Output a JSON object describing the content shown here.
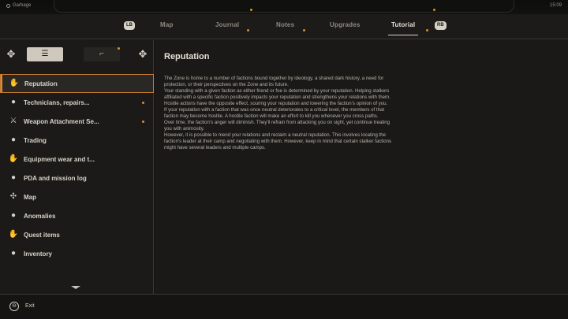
{
  "status_bar": {
    "location": "Garbage",
    "time": "15:09"
  },
  "nav": {
    "left_bumper": "LB",
    "right_bumper": "RB",
    "tabs": [
      {
        "label": "Map",
        "notify": false
      },
      {
        "label": "Journal",
        "notify": true
      },
      {
        "label": "Notes",
        "notify": true
      },
      {
        "label": "Upgrades",
        "notify": false
      },
      {
        "label": "Tutorial",
        "notify": true,
        "active": true
      }
    ]
  },
  "sidebar": {
    "tabs": [
      {
        "icon": "list-icon",
        "active": true
      },
      {
        "icon": "weapon-icon",
        "active": false,
        "notify": true
      }
    ],
    "items": [
      {
        "label": "Reputation",
        "icon": "hand-icon",
        "active": true
      },
      {
        "label": "Technicians, repairs...",
        "icon": "bag-icon",
        "notify": true
      },
      {
        "label": "Weapon Attachment Se...",
        "icon": "rifle-icon",
        "notify": true
      },
      {
        "label": "Trading",
        "icon": "bag-icon"
      },
      {
        "label": "Equipment wear and t...",
        "icon": "hand-icon"
      },
      {
        "label": "PDA and mission log",
        "icon": "bag-icon"
      },
      {
        "label": "Map",
        "icon": "compass-icon"
      },
      {
        "label": "Anomalies",
        "icon": "bag-icon"
      },
      {
        "label": "Quest items",
        "icon": "hand-icon"
      },
      {
        "label": "Inventory",
        "icon": "bag-icon"
      }
    ]
  },
  "content": {
    "title": "Reputation",
    "paragraphs": [
      "The Zone is home to a number of factions bound together by ideology, a shared dark history, a need for protection, or their perspectives on the Zone and its future.",
      "Your standing with a given faction as either friend or foe is determined by your reputation. Helping stalkers affiliated with a specific faction positively impacts your reputation and strengthens your relations with them.",
      "Hostile actions have the opposite effect, souring your reputation and lowering the faction's opinion of you.",
      "If your reputation with a faction that was once neutral deteriorates to a critical level, the members of that faction may become hostile. A hostile faction will make an effort to kill you whenever you cross paths.",
      "Over time, the faction's anger will diminish. They'll refrain from attacking you on sight, yet continue treating you with animosity.",
      "However, it is possible to mend your relations and reclaim a neutral reputation. This involves locating the faction's leader at their camp and negotiating with them. However, keep in mind that certain stalker factions might have several leaders and multiple camps."
    ]
  },
  "footer": {
    "exit_label": "Exit"
  },
  "colors": {
    "accent": "#e08a2e",
    "panel": "#1b1a18",
    "text": "#c9c4bb"
  }
}
